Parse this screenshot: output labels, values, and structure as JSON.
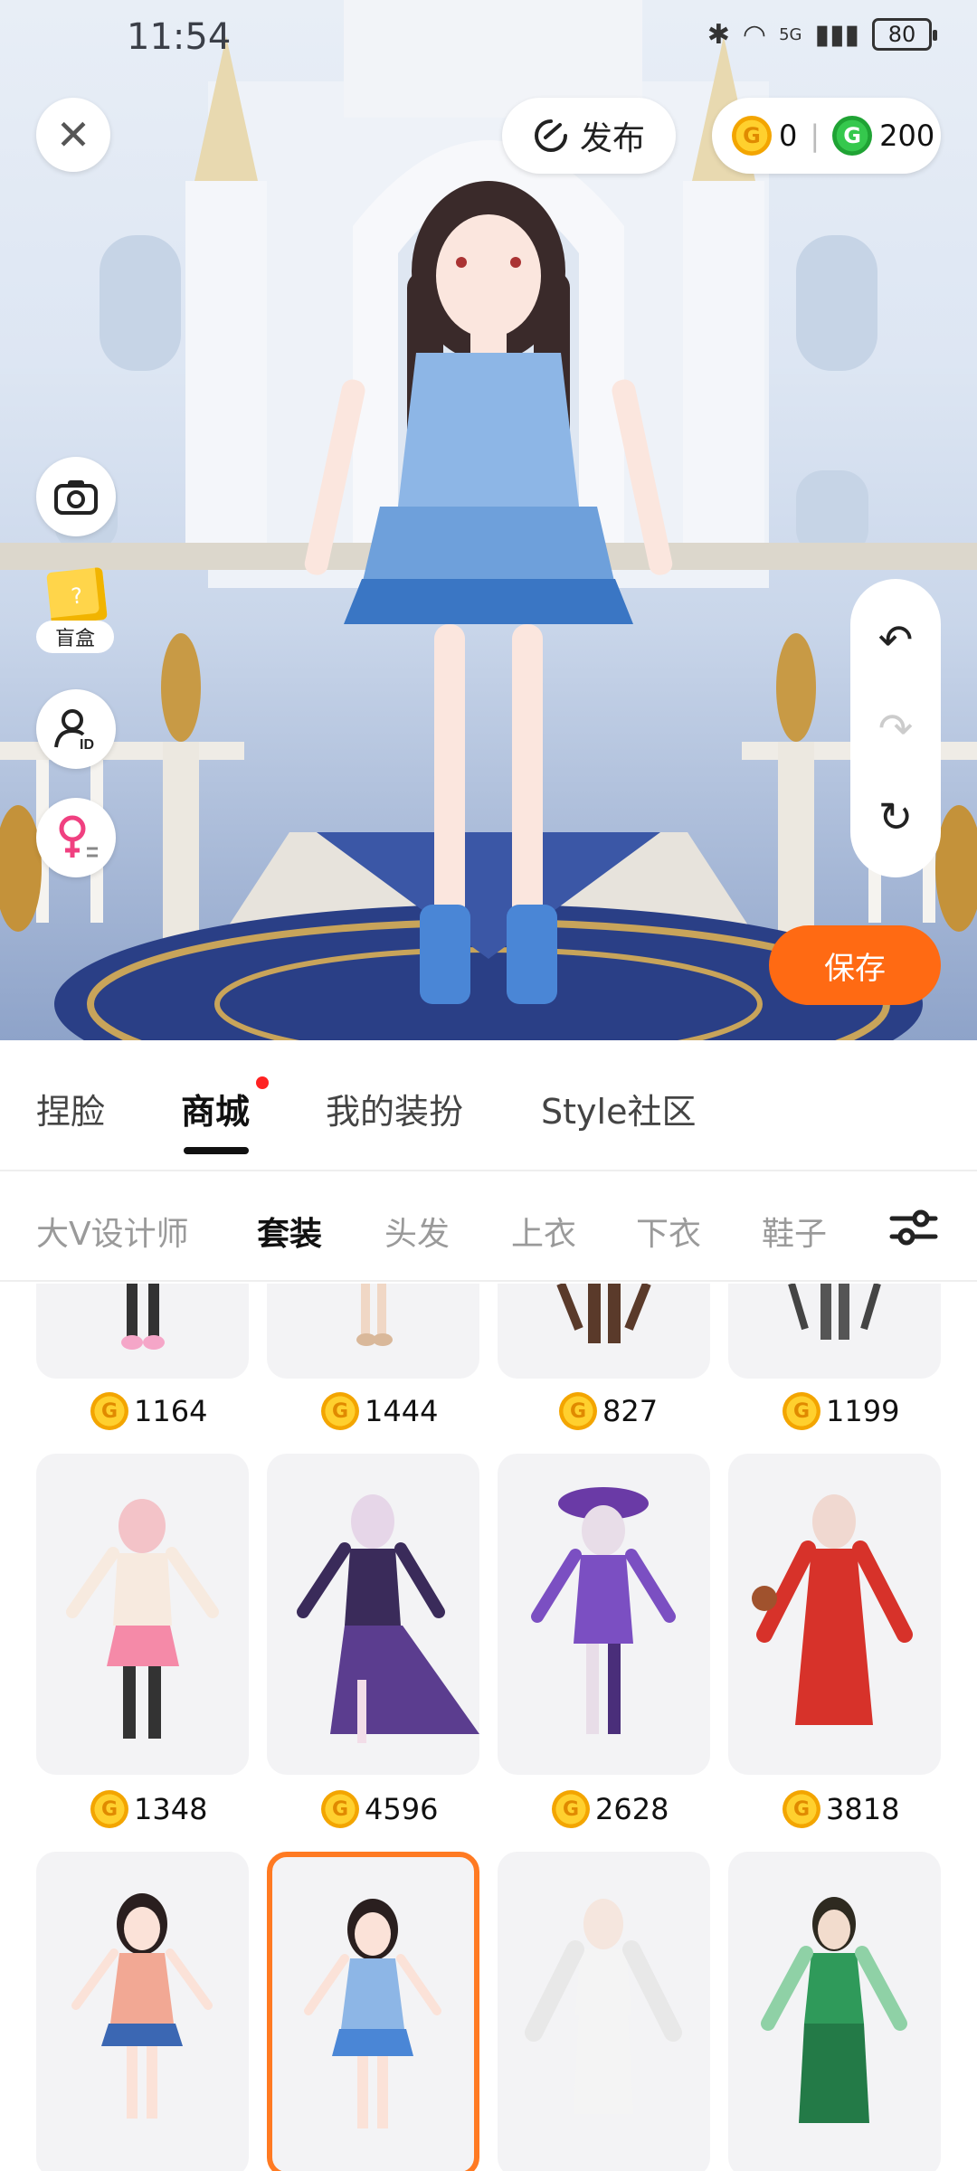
{
  "status_bar": {
    "time": "11:54",
    "battery": "80",
    "network": "5G"
  },
  "header": {
    "publish_label": "发布",
    "gold_coins": "0",
    "green_coins": "200"
  },
  "left_tools": {
    "blind_box_label": "盲盒"
  },
  "save_label": "保存",
  "main_tabs": [
    {
      "label": "捏脸"
    },
    {
      "label": "商城"
    },
    {
      "label": "我的装扮"
    },
    {
      "label": "Style社区"
    }
  ],
  "sub_tabs": [
    {
      "label": "大V设计师"
    },
    {
      "label": "套装"
    },
    {
      "label": "头发"
    },
    {
      "label": "上衣"
    },
    {
      "label": "下衣"
    },
    {
      "label": "鞋子"
    }
  ],
  "outfits": [
    {
      "price": "1164"
    },
    {
      "price": "1444"
    },
    {
      "price": "827"
    },
    {
      "price": "1199"
    },
    {
      "price": "1348"
    },
    {
      "price": "4596"
    },
    {
      "price": "2628"
    },
    {
      "price": "3818"
    },
    {
      "price": ""
    },
    {
      "price": ""
    },
    {
      "price": ""
    },
    {
      "price": ""
    }
  ],
  "colors": {
    "accent": "#ff6a13",
    "gold_coin": "#ffc21a",
    "green_coin": "#2cb843",
    "selected_border": "#ff7a22"
  }
}
